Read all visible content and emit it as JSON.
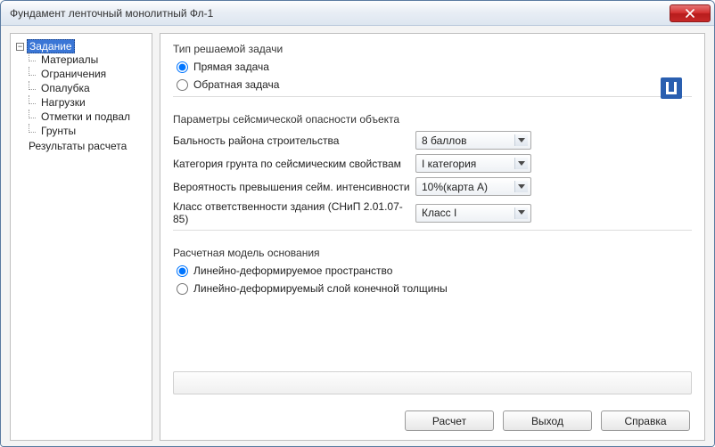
{
  "window": {
    "title": "Фундамент ленточный монолитный Фл-1"
  },
  "tree": {
    "root": "Задание",
    "children": [
      "Материалы",
      "Ограничения",
      "Опалубка",
      "Нагрузки",
      "Отметки и подвал",
      "Грунты"
    ],
    "second": "Результаты расчета"
  },
  "task_type": {
    "legend": "Тип решаемой задачи",
    "options": {
      "direct": "Прямая задача",
      "inverse": "Обратная задача"
    },
    "selected": "direct"
  },
  "seismic": {
    "legend": "Параметры сейсмической опасности объекта",
    "rows": {
      "ballnost": {
        "label": "Бальность района строительства",
        "value": "8 баллов"
      },
      "category": {
        "label": "Категория грунта по сейсмическим свойствам",
        "value": "I категория"
      },
      "probability": {
        "label": "Вероятность превышения сейм. интенсивности",
        "value": "10%(карта А)"
      },
      "class": {
        "label": "Класс ответственности здания (СНиП 2.01.07-85)",
        "value": "Класс I"
      }
    }
  },
  "model": {
    "legend": "Расчетная модель основания",
    "options": {
      "space": "Линейно-деформируемое пространство",
      "layer": "Линейно-деформируемый слой конечной толщины"
    },
    "selected": "space"
  },
  "buttons": {
    "calc": "Расчет",
    "exit": "Выход",
    "help": "Справка"
  }
}
